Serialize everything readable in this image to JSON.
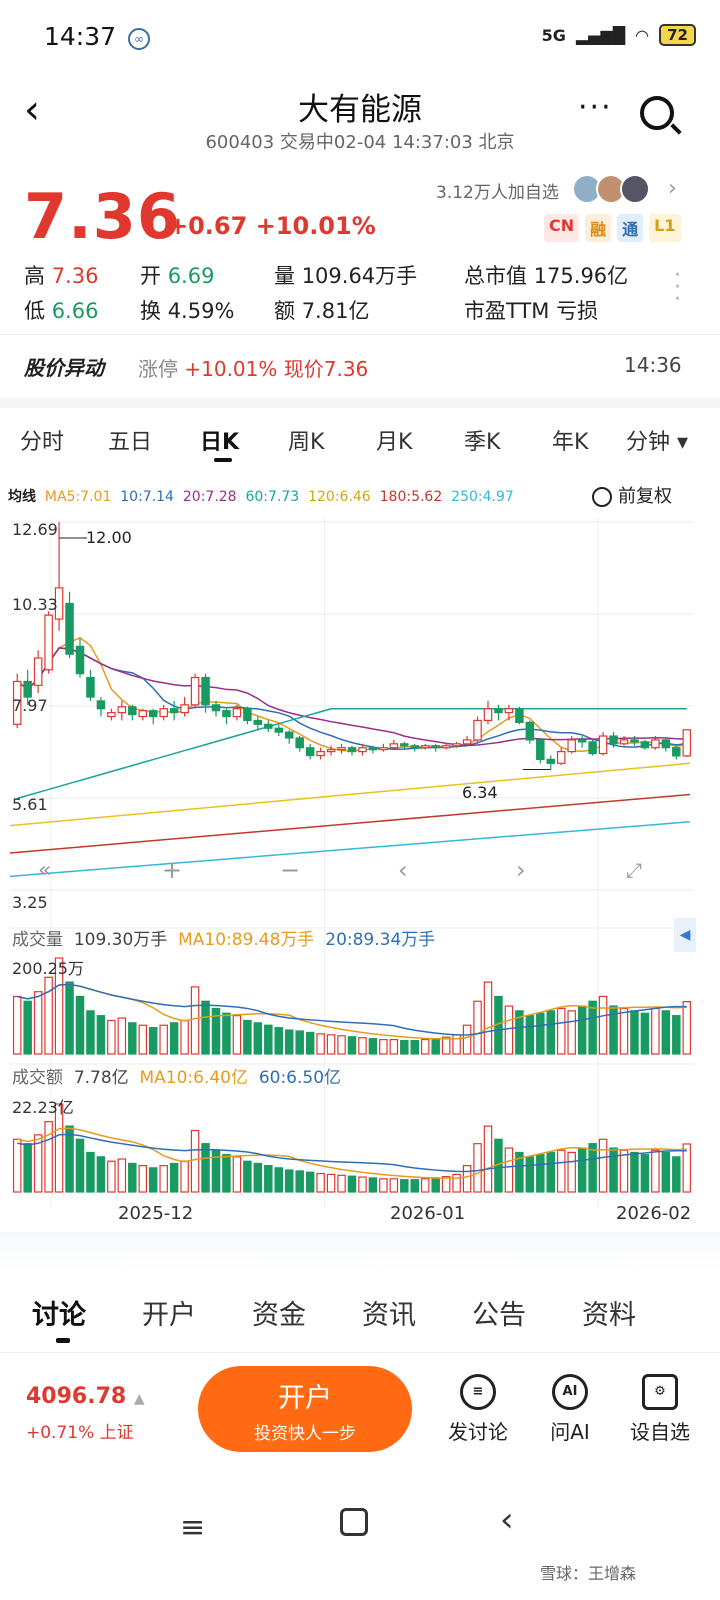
{
  "status": {
    "time": "14:37",
    "network": "5G",
    "signal": "signal-icon",
    "wifi": "wifi-icon",
    "battery": "72"
  },
  "header": {
    "title": "大有能源",
    "subtitle": "600403 交易中02-04 14:37:03 北京"
  },
  "quote": {
    "price": "7.36",
    "change": "+0.67 +10.01%",
    "followers": "3.12万人加自选",
    "tags": [
      "CN",
      "融",
      "通",
      "L1"
    ]
  },
  "stats": {
    "high_label": "高",
    "high": "7.36",
    "open_label": "开",
    "open": "6.69",
    "vol_label": "量",
    "vol": "109.64万手",
    "mcap_label": "总市值",
    "mcap": "175.96亿",
    "low_label": "低",
    "low": "6.66",
    "turn_label": "换",
    "turn": "4.59%",
    "amt_label": "额",
    "amt": "7.81亿",
    "pe_label": "市盈TTM",
    "pe": "亏损"
  },
  "alert": {
    "title": "股价异动",
    "label": "涨停",
    "text": "+10.01% 现价7.36",
    "time": "14:36"
  },
  "ktabs": [
    "分时",
    "五日",
    "日K",
    "周K",
    "月K",
    "季K",
    "年K",
    "分钟 ▾"
  ],
  "ma": {
    "label": "均线",
    "ma5": "MA5:7.01",
    "ma10": "10:7.14",
    "ma20": "20:7.28",
    "ma60": "60:7.73",
    "ma120": "120:6.46",
    "ma180": "180:5.62",
    "ma250": "250:4.97",
    "fq": "前复权"
  },
  "colors": {
    "up": "#e0372f",
    "down": "#1a9a63",
    "ma5": "#e89a1a",
    "ma10": "#2f6db5",
    "ma20": "#9b2d8f",
    "ma60": "#1aa39a",
    "ma120": "#e8c21a",
    "ma180": "#c0392b",
    "ma250": "#35b7d6"
  },
  "price_axis": {
    "top": "12.69",
    "hi_mark": "12.00",
    "l2": "10.33",
    "l3": "7.97",
    "low_mark": "6.34",
    "l4": "5.61",
    "bottom": "3.25"
  },
  "volume": {
    "label": "成交量",
    "value": "109.30万手",
    "ma10": "MA10:89.48万手",
    "ma20": "20:89.34万手",
    "max": "200.25万"
  },
  "amount": {
    "label": "成交额",
    "value": "7.78亿",
    "ma10": "MA10:6.40亿",
    "ma60": "60:6.50亿",
    "max": "22.23亿"
  },
  "xaxis": [
    "2025-12",
    "2026-01",
    "2026-02"
  ],
  "chart_data": {
    "type": "candlestick",
    "ylim": [
      3.25,
      12.69
    ],
    "candles": [
      [
        7.5,
        8.6,
        7.4,
        8.8
      ],
      [
        8.6,
        8.2,
        8.0,
        8.9
      ],
      [
        8.5,
        9.2,
        8.3,
        9.4
      ],
      [
        8.9,
        10.3,
        8.8,
        10.4
      ],
      [
        10.2,
        11.0,
        9.9,
        12.69
      ],
      [
        10.6,
        9.3,
        9.2,
        10.9
      ],
      [
        9.5,
        8.8,
        8.7,
        9.7
      ],
      [
        8.7,
        8.2,
        8.1,
        8.9
      ],
      [
        8.1,
        7.9,
        7.7,
        8.2
      ],
      [
        7.7,
        7.8,
        7.6,
        7.9
      ],
      [
        7.8,
        7.95,
        7.6,
        8.1
      ],
      [
        7.95,
        7.75,
        7.6,
        8.0
      ],
      [
        7.7,
        7.85,
        7.6,
        7.9
      ],
      [
        7.85,
        7.7,
        7.5,
        7.9
      ],
      [
        7.7,
        7.9,
        7.6,
        8.0
      ],
      [
        7.9,
        7.8,
        7.6,
        8.1
      ],
      [
        7.8,
        8.0,
        7.7,
        8.2
      ],
      [
        8.0,
        8.7,
        7.9,
        8.8
      ],
      [
        8.7,
        8.0,
        7.8,
        8.8
      ],
      [
        8.0,
        7.85,
        7.7,
        8.1
      ],
      [
        7.85,
        7.7,
        7.5,
        7.9
      ],
      [
        7.7,
        7.9,
        7.6,
        8.0
      ],
      [
        7.9,
        7.6,
        7.5,
        7.95
      ],
      [
        7.6,
        7.5,
        7.35,
        7.7
      ],
      [
        7.5,
        7.4,
        7.3,
        7.6
      ],
      [
        7.4,
        7.3,
        7.2,
        7.5
      ],
      [
        7.3,
        7.15,
        7.0,
        7.35
      ],
      [
        7.15,
        6.9,
        6.8,
        7.2
      ],
      [
        6.9,
        6.7,
        6.6,
        7.0
      ],
      [
        6.7,
        6.8,
        6.6,
        6.9
      ],
      [
        6.8,
        6.85,
        6.7,
        6.95
      ],
      [
        6.85,
        6.9,
        6.75,
        7.0
      ],
      [
        6.9,
        6.8,
        6.7,
        6.95
      ],
      [
        6.8,
        6.9,
        6.7,
        7.0
      ],
      [
        6.9,
        6.85,
        6.75,
        6.95
      ],
      [
        6.85,
        6.9,
        6.8,
        7.0
      ],
      [
        6.9,
        7.0,
        6.85,
        7.1
      ],
      [
        7.0,
        6.95,
        6.85,
        7.05
      ],
      [
        6.95,
        6.9,
        6.8,
        7.0
      ],
      [
        6.9,
        6.95,
        6.85,
        7.0
      ],
      [
        6.95,
        6.9,
        6.8,
        7.0
      ],
      [
        6.9,
        6.95,
        6.85,
        7.0
      ],
      [
        6.95,
        7.0,
        6.9,
        7.05
      ],
      [
        7.0,
        7.1,
        6.95,
        7.2
      ],
      [
        7.1,
        7.6,
        7.0,
        7.7
      ],
      [
        7.6,
        7.9,
        7.5,
        8.1
      ],
      [
        7.9,
        7.8,
        7.6,
        8.0
      ],
      [
        7.8,
        7.9,
        7.6,
        8.0
      ],
      [
        7.9,
        7.55,
        7.5,
        7.95
      ],
      [
        7.55,
        7.1,
        7.0,
        7.6
      ],
      [
        7.1,
        6.6,
        6.5,
        7.15
      ],
      [
        6.6,
        6.5,
        6.34,
        6.7
      ],
      [
        6.5,
        6.8,
        6.45,
        6.9
      ],
      [
        6.8,
        7.1,
        6.75,
        7.2
      ],
      [
        7.1,
        7.05,
        6.9,
        7.2
      ],
      [
        7.05,
        6.75,
        6.7,
        7.1
      ],
      [
        6.75,
        7.2,
        6.7,
        7.3
      ],
      [
        7.2,
        7.0,
        6.9,
        7.3
      ],
      [
        7.0,
        7.1,
        6.95,
        7.2
      ],
      [
        7.1,
        7.05,
        6.95,
        7.2
      ],
      [
        7.05,
        6.9,
        6.85,
        7.1
      ],
      [
        6.9,
        7.1,
        6.85,
        7.2
      ],
      [
        7.1,
        6.9,
        6.8,
        7.15
      ],
      [
        6.9,
        6.69,
        6.6,
        6.95
      ],
      [
        6.69,
        7.36,
        6.66,
        7.36
      ]
    ],
    "volume": [
      120,
      110,
      130,
      160,
      200.25,
      150,
      120,
      90,
      80,
      70,
      75,
      65,
      60,
      55,
      60,
      65,
      70,
      140,
      110,
      95,
      85,
      80,
      70,
      65,
      60,
      55,
      50,
      48,
      45,
      42,
      40,
      38,
      36,
      34,
      32,
      30,
      30,
      28,
      28,
      30,
      32,
      35,
      40,
      60,
      110,
      150,
      120,
      100,
      90,
      80,
      85,
      90,
      95,
      90,
      100,
      110,
      120,
      100,
      95,
      90,
      85,
      95,
      90,
      80,
      109.3
    ]
  },
  "bottom_tabs": [
    "讨论",
    "开户",
    "资金",
    "资讯",
    "公告",
    "资料"
  ],
  "index": {
    "value": "4096.78",
    "sub": "+0.71% 上证"
  },
  "cta": {
    "main": "开户",
    "sub": "投资快人一步"
  },
  "actions": [
    {
      "label": "发讨论",
      "icon": "chat-icon"
    },
    {
      "label": "问AI",
      "icon": "ai-icon"
    },
    {
      "label": "设自选",
      "icon": "add-watch-icon"
    }
  ],
  "watermark": "雪球：王增森"
}
